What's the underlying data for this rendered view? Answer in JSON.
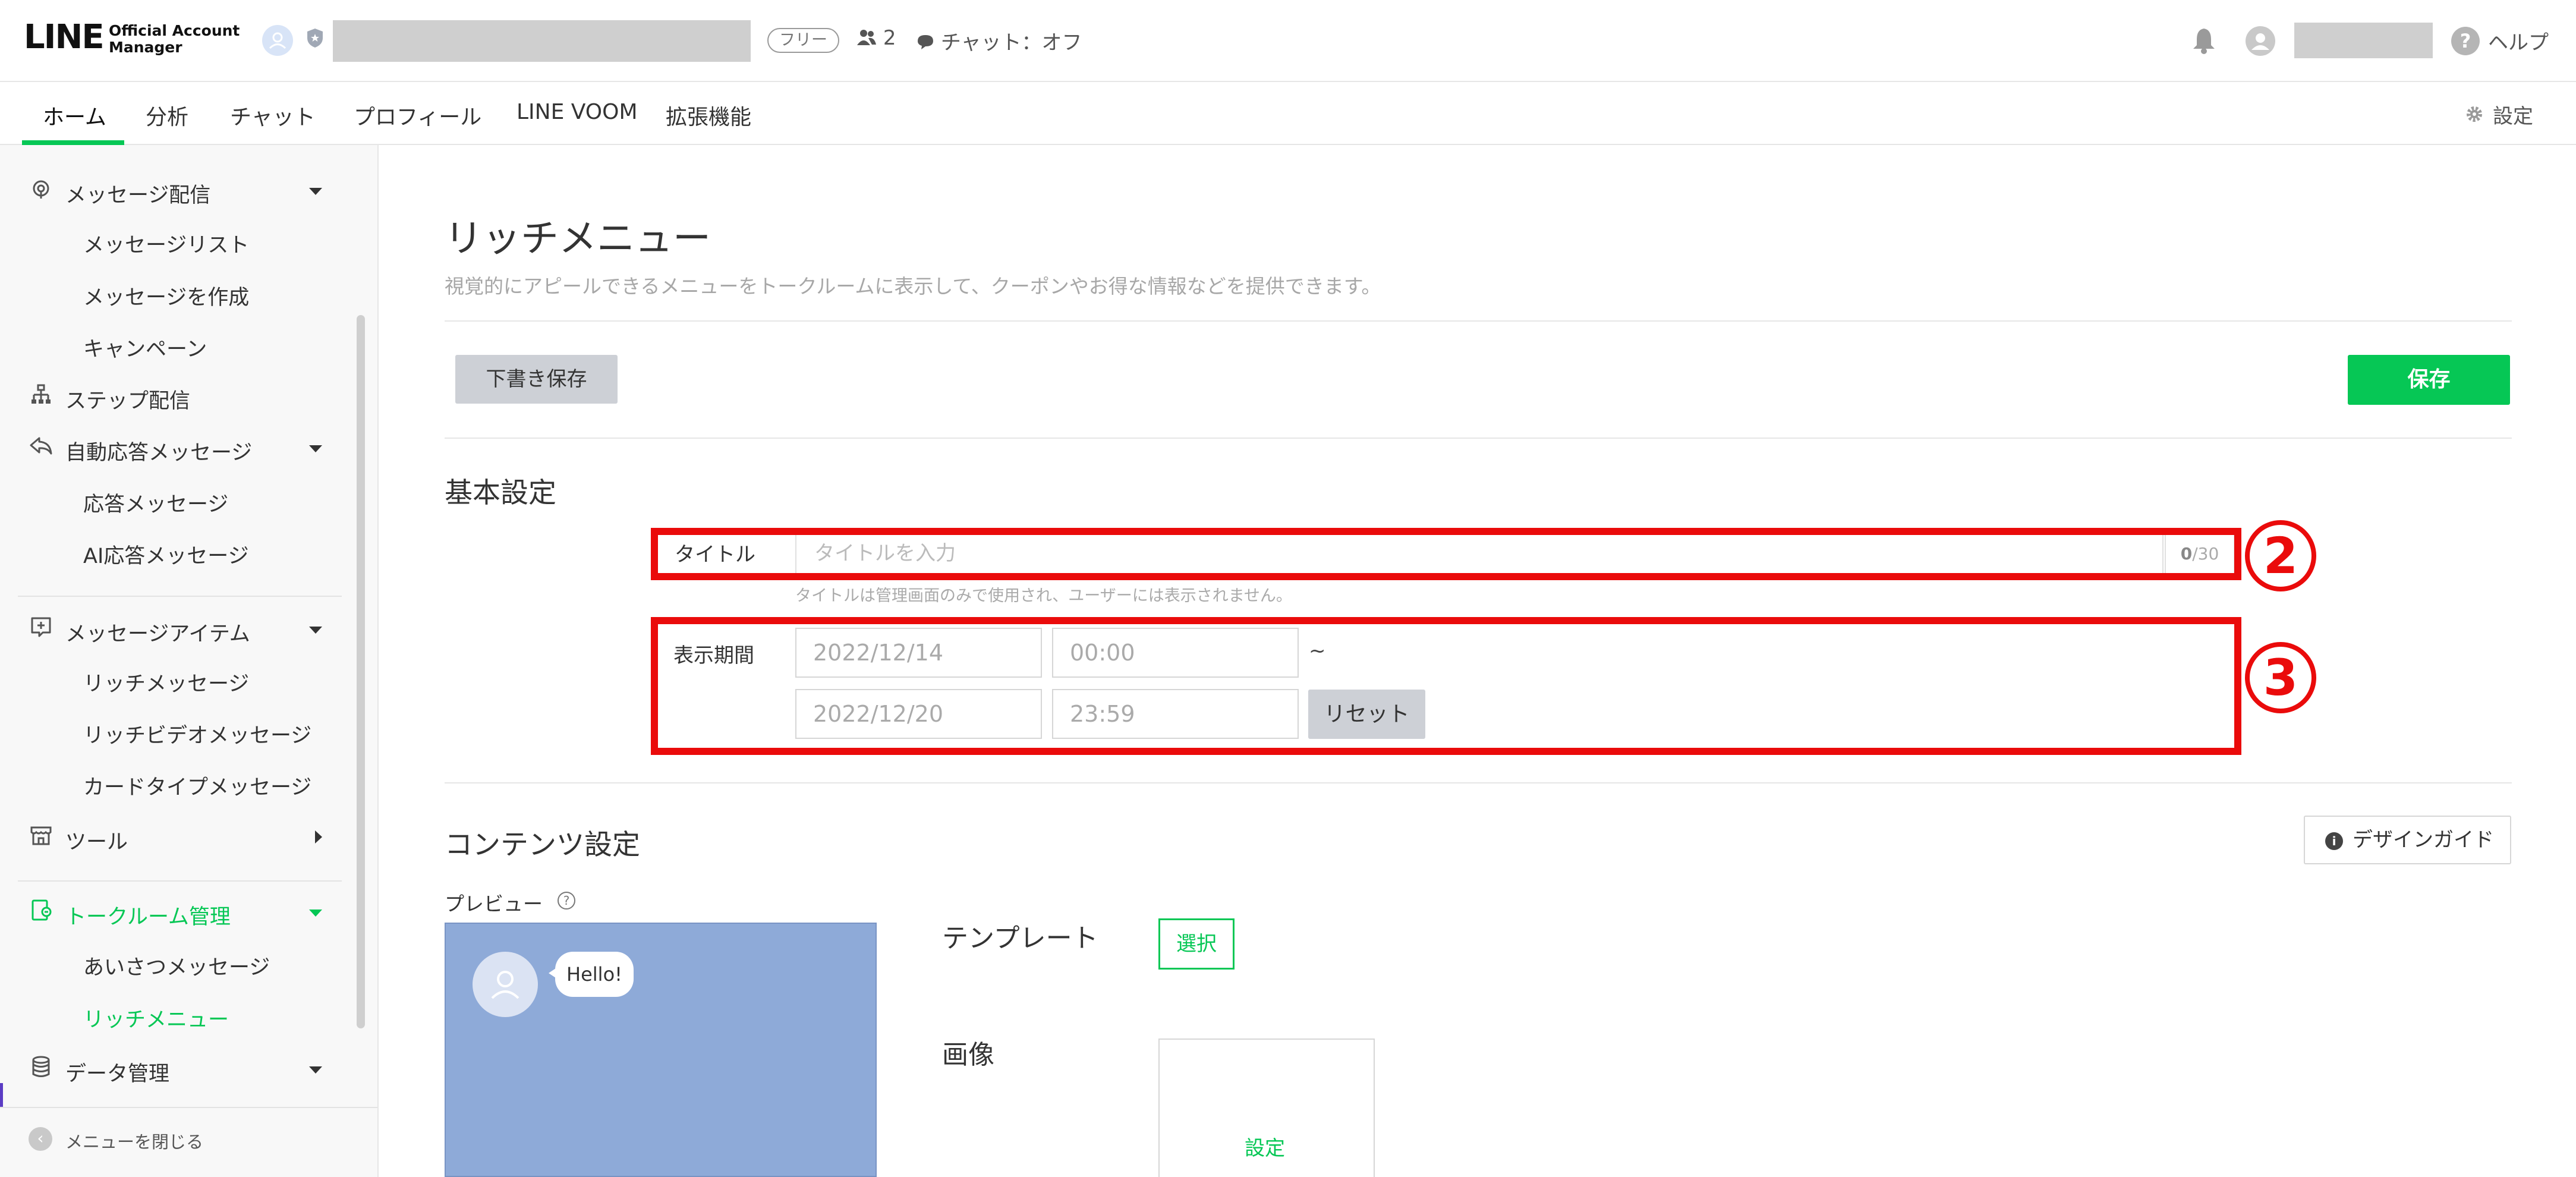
{
  "header": {
    "logo_main": "LINE",
    "logo_sub_1": "Official Account",
    "logo_sub_2": "Manager",
    "plan_badge": "フリー",
    "friends_count": "2",
    "chat_status": "チャット：オフ",
    "help_label": "ヘルプ"
  },
  "nav": {
    "tabs": [
      "ホーム",
      "分析",
      "チャット",
      "プロフィール",
      "LINE VOOM",
      "拡張機能"
    ],
    "active_tab": "ホーム",
    "settings_label": "設定"
  },
  "sidebar": {
    "items": [
      {
        "label": "メッセージ配信",
        "icon": "broadcast-icon",
        "expanded": true
      },
      {
        "label": "メッセージリスト",
        "sub": true
      },
      {
        "label": "メッセージを作成",
        "sub": true
      },
      {
        "label": "キャンペーン",
        "sub": true
      },
      {
        "label": "ステップ配信",
        "icon": "flow-icon"
      },
      {
        "label": "自動応答メッセージ",
        "icon": "reply-icon",
        "expanded": true
      },
      {
        "label": "応答メッセージ",
        "sub": true
      },
      {
        "label": "AI応答メッセージ",
        "sub": true
      },
      {
        "label": "メッセージアイテム",
        "icon": "add-box-icon",
        "expanded": true
      },
      {
        "label": "リッチメッセージ",
        "sub": true
      },
      {
        "label": "リッチビデオメッセージ",
        "sub": true
      },
      {
        "label": "カードタイプメッセージ",
        "sub": true
      },
      {
        "label": "ツール",
        "icon": "store-icon",
        "expanded": false
      },
      {
        "label": "トークルーム管理",
        "icon": "chatroom-icon",
        "expanded": true,
        "active": true
      },
      {
        "label": "あいさつメッセージ",
        "sub": true
      },
      {
        "label": "リッチメニュー",
        "sub": true,
        "active": true
      },
      {
        "label": "データ管理",
        "icon": "database-icon",
        "expanded": true
      }
    ],
    "close_menu_label": "メニューを閉じる"
  },
  "main": {
    "page_title": "リッチメニュー",
    "page_description": "視覚的にアピールできるメニューをトークルームに表示して、クーポンやお得な情報などを提供できます。",
    "draft_save_button": "下書き保存",
    "save_button": "保存",
    "basic_settings": {
      "heading": "基本設定",
      "title_label": "タイトル",
      "title_placeholder": "タイトルを入力",
      "title_count": "0",
      "title_max": "/30",
      "title_hint": "タイトルは管理画面のみで使用され、ユーザーには表示されません。",
      "period_label": "表示期間",
      "start_date": "2022/12/14",
      "start_time": "00:00",
      "separator": "~",
      "end_date": "2022/12/20",
      "end_time": "23:59",
      "reset_button": "リセット"
    },
    "content_settings": {
      "heading": "コンテンツ設定",
      "design_guide_button": "デザインガイド",
      "preview_label": "プレビュー",
      "preview_bubble": "Hello!",
      "template_label": "テンプレート",
      "select_button": "選択",
      "image_label": "画像",
      "image_set_link": "設定"
    },
    "annotations": [
      "2",
      "3"
    ]
  },
  "colors": {
    "brand_green": "#06C755",
    "annotation_red": "#EA0B0B",
    "preview_blue": "#8EAAD8"
  }
}
